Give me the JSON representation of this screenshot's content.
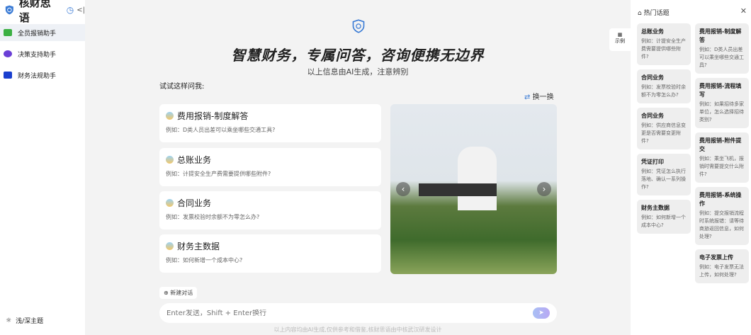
{
  "app": {
    "name": "核财思语"
  },
  "sidebar": {
    "items": [
      {
        "label": "全员报销助手",
        "color": "#3cb043"
      },
      {
        "label": "决策支持助手",
        "color": "#6a3fd6"
      },
      {
        "label": "财务法规助手",
        "color": "#1a3fcf"
      }
    ],
    "theme": "浅/深主题"
  },
  "main": {
    "title": "智慧财务，专属问答，咨询便携无边界",
    "subtitle": "以上信息由AI生成，注意辨别",
    "try": "试试这样问我:",
    "swap": "换一换",
    "cards": [
      {
        "title": "费用报销-制度解答",
        "desc": "例如：D类人员出差可以乘坐哪些交通工具?"
      },
      {
        "title": "总账业务",
        "desc": "例如：计提安全生产费需要提供哪些附件?"
      },
      {
        "title": "合同业务",
        "desc": "例如：发票校验时余额不为零怎么办?"
      },
      {
        "title": "财务主数据",
        "desc": "例如：如何新增一个成本中心?"
      }
    ],
    "new_chat": "新建对话",
    "input_placeholder": "Enter发送，Shift + Enter换行",
    "footer": "以上内容均由AI生成,仅供参考和借鉴,核财思语由中核武汉研发设计",
    "example": "示例"
  },
  "right": {
    "title": "热门话题",
    "col1": [
      {
        "title": "总账业务",
        "desc": "例如：计提安全生产费需要提供哪些附件?"
      },
      {
        "title": "合同业务",
        "desc": "例如：发票校验时余额不为零怎么办?"
      },
      {
        "title": "合同业务",
        "desc": "例如：供应商信息变更是否需要变更附件?"
      },
      {
        "title": "凭证打印",
        "desc": "例如：凭证怎么执行落地、确认一系列操作?"
      },
      {
        "title": "财务主数据",
        "desc": "例如：如何新增一个成本中心?"
      }
    ],
    "col2": [
      {
        "title": "费用报销-制度解答",
        "desc": "例如：D类人员出差可以乘坐哪些交通工具?"
      },
      {
        "title": "费用报销-流程填写",
        "desc": "例如：如果招待多家单位，怎么选择招待类别?"
      },
      {
        "title": "费用报销-附件提交",
        "desc": "例如：乘坐飞机，报销时需要提交什么附件?"
      },
      {
        "title": "费用报销-系统操作",
        "desc": "例如：提交报销流程时系统报错：请等待商旅返回信息，如何处理?"
      },
      {
        "title": "电子发票上传",
        "desc": "例如：电子发票无法上传，如何处理?"
      }
    ]
  }
}
